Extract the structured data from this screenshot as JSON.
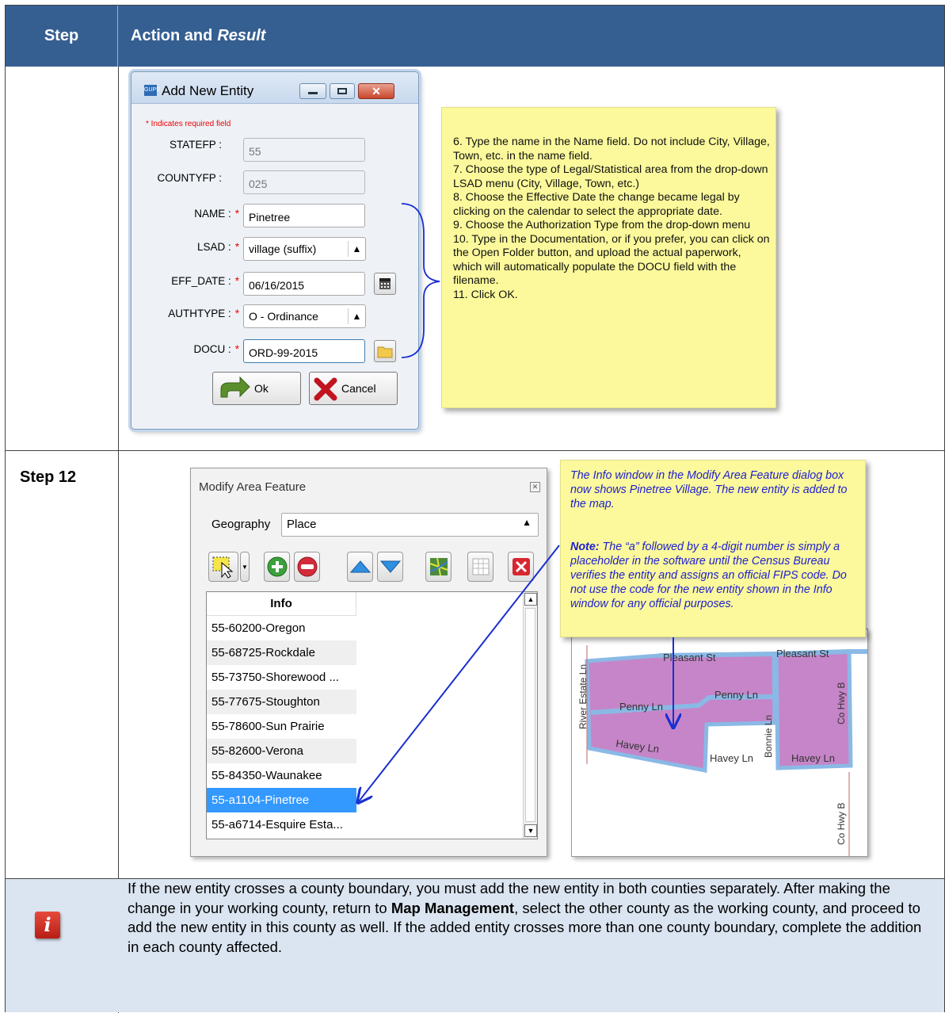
{
  "header": {
    "step": "Step",
    "action": "Action and",
    "result": "Result"
  },
  "step12": "Step 12",
  "dialog1": {
    "title": "Add New Entity",
    "app_icon_text": "GUPS",
    "required_note": "* Indicates required field",
    "fields": {
      "statefp_label": "STATEFP :",
      "statefp_value": "55",
      "countyfp_label": "COUNTYFP :",
      "countyfp_value": "025",
      "name_label": "NAME :",
      "name_value": "Pinetree",
      "lsad_label": "LSAD :",
      "lsad_value": "village (suffix)",
      "effdate_label": "EFF_DATE :",
      "effdate_value": "06/16/2015",
      "authtype_label": "AUTHTYPE :",
      "authtype_value": "O - Ordinance",
      "docu_label": "DOCU :",
      "docu_value": "ORD-99-2015"
    },
    "ok_label": "Ok",
    "cancel_label": "Cancel"
  },
  "sticky1": "6. Type the name in the Name field. Do not include City, Village, Town, etc. in the name field.\n7. Choose the type of Legal/Statistical area from the drop-down LSAD menu (City, Village, Town, etc.)\n8. Choose the Effective Date the change became legal by clicking on the calendar to select the appropriate date.\n9. Choose the Authorization Type from the drop-down menu\n10. Type in the Documentation, or if you prefer, you can click on the Open Folder button, and upload the actual paperwork, which will automatically populate the DOCU field with the filename.\n11. Click OK.",
  "dialog2": {
    "title": "Modify Area Feature",
    "geography_label": "Geography",
    "geography_value": "Place",
    "list_header": "Info",
    "items": [
      "55-60200-Oregon",
      "55-68725-Rockdale",
      "55-73750-Shorewood ...",
      "55-77675-Stoughton",
      "55-78600-Sun Prairie",
      "55-82600-Verona",
      "55-84350-Waunakee",
      "55-a1104-Pinetree",
      "55-a6714-Esquire Esta..."
    ],
    "selected_index": 7
  },
  "sticky2": {
    "para1": "The Info window in the Modify Area Feature dialog box now shows Pinetree Village. The new entity is added to the map.",
    "note_label": "Note:",
    "para2": " The “a” followed by a 4-digit number is simply a placeholder in the software until the Census Bureau verifies the entity and assigns an official FIPS code. Do not use the code for the new entity shown in the Info window for any official purposes."
  },
  "map_labels": {
    "pleasant1": "Pleasant St",
    "pleasant2": "Pleasant St",
    "penny1": "Penny Ln",
    "penny2": "Penny Ln",
    "havey1": "Havey Ln",
    "havey2": "Havey Ln",
    "havey3": "Havey Ln",
    "river": "River Estate Ln",
    "bonnie": "Bonnie Ln",
    "cohwy1": "Co Hwy B",
    "cohwy2": "Co Hwy B"
  },
  "note": {
    "t1": "If the new entity crosses a county boundary, you must add the new entity in both counties separately.  After making the change in your working county, return to ",
    "bold": "Map Management",
    "t2": ", select the other county as the working county, and proceed to add the new entity in this county as well.  If the added entity crosses more than one county boundary, complete the addition in each county affected."
  },
  "colors": {
    "header_bg": "#365f91",
    "note_bg": "#dbe5f1",
    "sticky": "#fbf99b",
    "polygon": "#c685c8",
    "selection": "#3399ff"
  }
}
